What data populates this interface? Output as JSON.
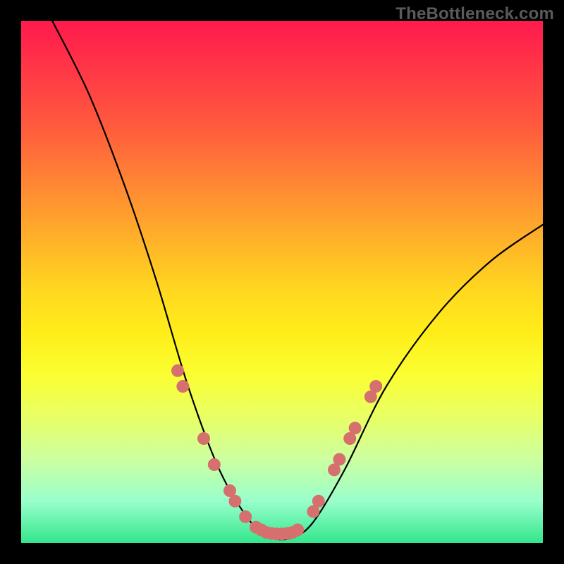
{
  "watermark": "TheBottleneck.com",
  "colors": {
    "dot": "#d6706f",
    "curve": "#000000",
    "frame": "#000000"
  },
  "chart_data": {
    "type": "line",
    "title": "",
    "xlabel": "",
    "ylabel": "",
    "xlim": [
      0,
      100
    ],
    "ylim": [
      0,
      100
    ],
    "grid": false,
    "note": "Stylized bottleneck curve over a red→green vertical gradient. No numeric axes or tick labels are rendered. Values below are estimated from pixel positions (x,y as percent of plot area, y=0 at bottom, y=100 at top).",
    "series": [
      {
        "name": "bottleneck-curve",
        "points": [
          {
            "x": 6,
            "y": 100
          },
          {
            "x": 13,
            "y": 86
          },
          {
            "x": 20,
            "y": 68
          },
          {
            "x": 26,
            "y": 50
          },
          {
            "x": 32,
            "y": 30
          },
          {
            "x": 38,
            "y": 14
          },
          {
            "x": 44,
            "y": 4
          },
          {
            "x": 48,
            "y": 1
          },
          {
            "x": 52,
            "y": 1
          },
          {
            "x": 56,
            "y": 4
          },
          {
            "x": 62,
            "y": 14
          },
          {
            "x": 70,
            "y": 30
          },
          {
            "x": 80,
            "y": 44
          },
          {
            "x": 90,
            "y": 54
          },
          {
            "x": 100,
            "y": 61
          }
        ]
      },
      {
        "name": "highlight-dots",
        "points": [
          {
            "x": 30,
            "y": 33
          },
          {
            "x": 31,
            "y": 30
          },
          {
            "x": 35,
            "y": 20
          },
          {
            "x": 37,
            "y": 15
          },
          {
            "x": 40,
            "y": 10
          },
          {
            "x": 41,
            "y": 8
          },
          {
            "x": 43,
            "y": 5
          },
          {
            "x": 45,
            "y": 3
          },
          {
            "x": 46,
            "y": 2.5
          },
          {
            "x": 47,
            "y": 2
          },
          {
            "x": 48,
            "y": 1.8
          },
          {
            "x": 49,
            "y": 1.7
          },
          {
            "x": 50,
            "y": 1.7
          },
          {
            "x": 51,
            "y": 1.8
          },
          {
            "x": 52,
            "y": 2
          },
          {
            "x": 53,
            "y": 2.5
          },
          {
            "x": 56,
            "y": 6
          },
          {
            "x": 57,
            "y": 8
          },
          {
            "x": 60,
            "y": 14
          },
          {
            "x": 61,
            "y": 16
          },
          {
            "x": 63,
            "y": 20
          },
          {
            "x": 64,
            "y": 22
          },
          {
            "x": 67,
            "y": 28
          },
          {
            "x": 68,
            "y": 30
          }
        ]
      }
    ]
  }
}
